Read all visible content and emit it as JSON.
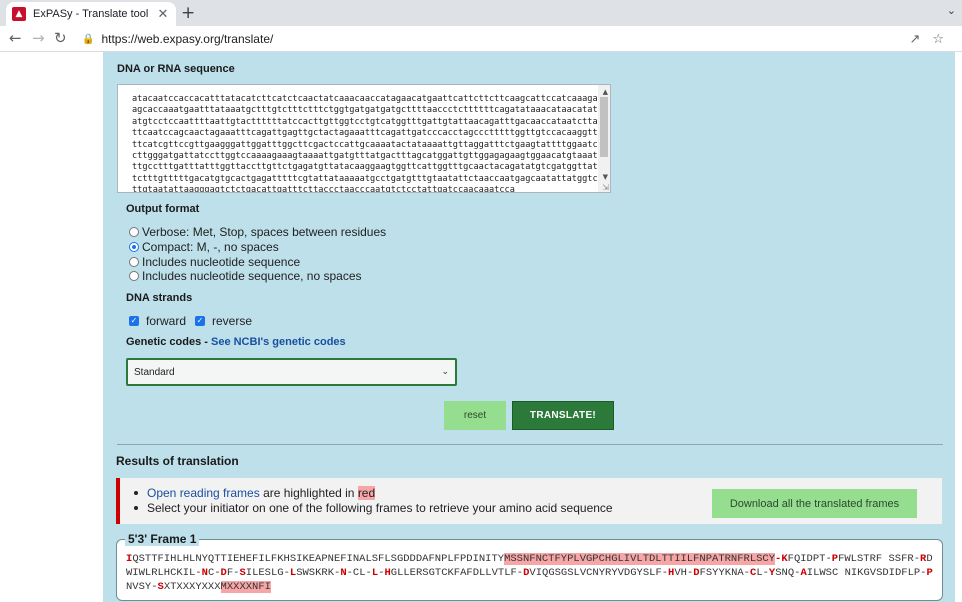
{
  "browser": {
    "tab_title": "ExPASy - Translate tool",
    "url": "https://web.expasy.org/translate/"
  },
  "form": {
    "sequence_label": "DNA or RNA sequence",
    "sequence_text": "atacaatccaccacatttatacatcttcatctcaactatcaaacaaccatagaacatgaattcattcttcttcaagcattccatcaaagaagcaccaaatgaatttataaatgctttgtctttctttctggtgatgatgatgcttttaaccctcttttttcagatataaacataacatatatgtcctccaattttaattgtacttttttatccacttgttggtcctgtcatggtttgattgtattaacagatttgacaaccataatcttattcaatccagcaactagaaatttcagattgagttgctactagaaatttcagattgatcccacctagccctttttggttgtccacaaggttttcatcgttccgttgaagggattggatttggcttcgactccattgcaaaatactataaaattgttaggatttctgaagtattttggaatccttgggatgattatccttggtccaaaagaaagtaaaattgatgtttatgactttagcatggattgttggagagaagtggaacatgtaaatttgcctttgatttatttggttaccttgttctgagatgttatacaaggaagtggttcattggtttgcaactacagatatgtcgatggttattctttgtttttgacatgtgcactgagatttttcgtattataaaaatgcctgatgtttgtaatattctaaccaatgagcaatattatggtcttgtaatattaagggagtctctgacattgatttcttaccctaacccaatgtctcctattgatccaacaaatcca",
    "output_format_label": "Output format",
    "output_options": [
      "Verbose: Met, Stop, spaces between residues",
      "Compact: M, -, no spaces",
      "Includes nucleotide sequence",
      "Includes nucleotide sequence, no spaces"
    ],
    "output_selected": "Compact: M, -, no spaces",
    "dna_strands_label": "DNA strands",
    "strand_forward": "forward",
    "strand_reverse": "reverse",
    "genetic_codes_label": "Genetic codes -",
    "genetic_codes_link": "See NCBI's genetic codes",
    "genetic_code_selected": "Standard",
    "reset_label": "reset",
    "translate_label": "TRANSLATE!"
  },
  "results": {
    "title": "Results of translation",
    "info_link": "Open reading frames",
    "info_mid": " are highlighted in ",
    "info_red": "red",
    "info_line2": "Select your initiator on one of the following frames to retrieve your amino acid sequence",
    "download_label": "Download all the translated frames",
    "frame_title": "5'3' Frame 1",
    "frame_segments": [
      {
        "t": "I",
        "c": "m"
      },
      {
        "t": "QSTTFIHLHLNYQTTIEHEFILFKHSIKEAPNEFINALSFLSGDDDAFNPLFPDINITY",
        "c": ""
      },
      {
        "t": "MSSNFNCTFYPLVGPCHGLIVLTDLTTIILFNPATRNFRLSCY",
        "c": "orf"
      },
      {
        "t": "-",
        "c": "m"
      },
      {
        "t": "K",
        "c": "m"
      },
      {
        "t": "FQIDPT-",
        "c": ""
      },
      {
        "t": "P",
        "c": "m"
      },
      {
        "t": "FWLSTRF SSFR-",
        "c": ""
      },
      {
        "t": "R",
        "c": "m"
      },
      {
        "t": "DWIWLRLHCKIL-",
        "c": ""
      },
      {
        "t": "N",
        "c": "m"
      },
      {
        "t": "C-",
        "c": ""
      },
      {
        "t": "D",
        "c": "m"
      },
      {
        "t": "F-",
        "c": ""
      },
      {
        "t": "S",
        "c": "m"
      },
      {
        "t": "ILESLG-",
        "c": ""
      },
      {
        "t": "L",
        "c": "m"
      },
      {
        "t": "SWSKRK-",
        "c": ""
      },
      {
        "t": "N",
        "c": "m"
      },
      {
        "t": "-CL-",
        "c": ""
      },
      {
        "t": "L",
        "c": "m"
      },
      {
        "t": "-",
        "c": ""
      },
      {
        "t": "H",
        "c": "m"
      },
      {
        "t": "GLLERSGTCKFAFDLLVTLF-",
        "c": ""
      },
      {
        "t": "D",
        "c": "m"
      },
      {
        "t": "VIQGSGSLVCNYRYVDGYSLF-",
        "c": ""
      },
      {
        "t": "H",
        "c": "m"
      },
      {
        "t": "VH-",
        "c": ""
      },
      {
        "t": "D",
        "c": "m"
      },
      {
        "t": "FSYYKNA-",
        "c": ""
      },
      {
        "t": "C",
        "c": "m"
      },
      {
        "t": "L-",
        "c": ""
      },
      {
        "t": "Y",
        "c": "m"
      },
      {
        "t": "SNQ-",
        "c": ""
      },
      {
        "t": "A",
        "c": "m"
      },
      {
        "t": "ILWSC NIKGVSDIDFLP-",
        "c": ""
      },
      {
        "t": "P",
        "c": "m"
      },
      {
        "t": "NVSY-",
        "c": ""
      },
      {
        "t": "S",
        "c": "m"
      },
      {
        "t": "XTXXXYXXX",
        "c": ""
      },
      {
        "t": "MXXXXNFI",
        "c": "orf"
      }
    ]
  },
  "icons": {
    "favicon": "expasy-logo-icon",
    "close": "close-icon",
    "new_tab": "plus-icon",
    "back": "arrow-left-icon",
    "forward": "arrow-right-icon",
    "reload": "reload-icon",
    "lock": "lock-icon",
    "share": "share-icon",
    "bookmark": "star-icon"
  }
}
